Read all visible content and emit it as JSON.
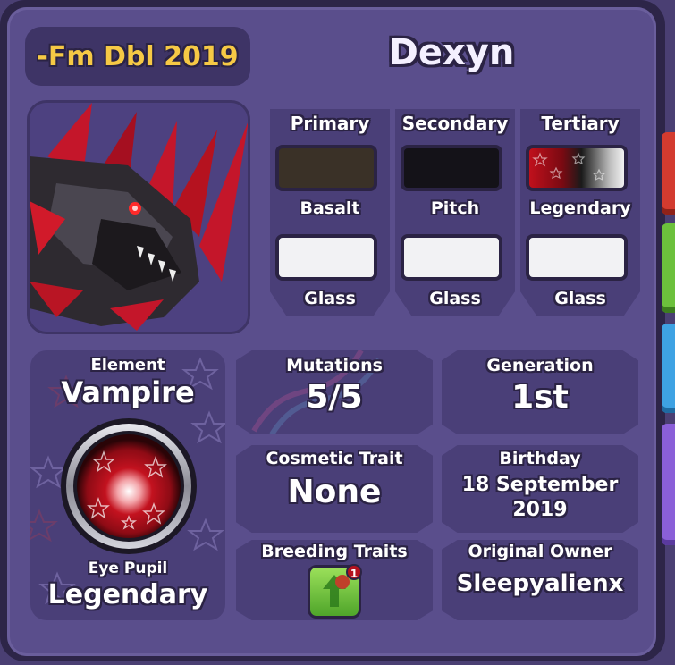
{
  "header": {
    "tag": "-Fm Dbl 2019",
    "name": "Dexyn"
  },
  "colors": {
    "columns": [
      {
        "heading": "Primary",
        "top_label": "Basalt",
        "top_color": "#3a3127",
        "bottom_label": "Glass",
        "bottom_color": "#f2f2f4"
      },
      {
        "heading": "Secondary",
        "top_label": "Pitch",
        "top_color": "#141218",
        "bottom_label": "Glass",
        "bottom_color": "#f2f2f4"
      },
      {
        "heading": "Tertiary",
        "top_label": "Legendary",
        "top_color": "#c0101c",
        "bottom_label": "Glass",
        "bottom_color": "#f2f2f4"
      }
    ]
  },
  "element": {
    "label": "Element",
    "value": "Vampire",
    "pupil_label": "Eye Pupil",
    "pupil_value": "Legendary"
  },
  "stats": {
    "mutations": {
      "label": "Mutations",
      "value": "5/5"
    },
    "generation": {
      "label": "Generation",
      "value": "1st"
    },
    "cosmetic": {
      "label": "Cosmetic Trait",
      "value": "None"
    },
    "birthday": {
      "label": "Birthday",
      "value_line1": "18 September",
      "value_line2": "2019"
    },
    "breeding": {
      "label": "Breeding Traits",
      "badge": "1"
    },
    "owner": {
      "label": "Original Owner",
      "value": "Sleepyalienx"
    }
  },
  "theme": {
    "panel": "#5a4e8c",
    "card": "#4a3f78",
    "tag_text": "#f6c945"
  }
}
